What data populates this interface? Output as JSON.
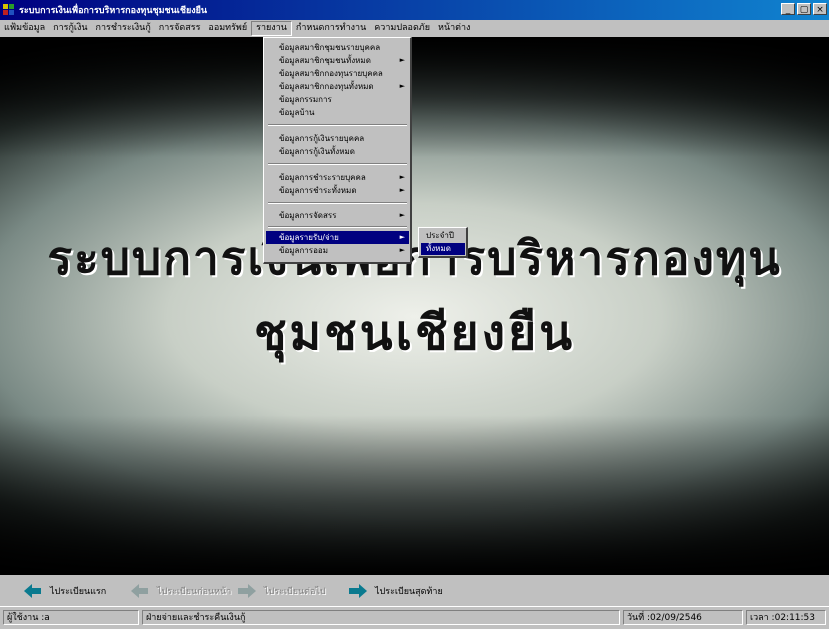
{
  "window": {
    "title": "ระบบการเงินเพื่อการบริหารกองทุนชุมชนเชียงยืน",
    "controls": [
      "_",
      "▢",
      "×"
    ]
  },
  "menubar": [
    {
      "label": "แฟ้มข้อมูล"
    },
    {
      "label": "การกู้เงิน"
    },
    {
      "label": "การชำระเงินกู้"
    },
    {
      "label": "การจัดสรร"
    },
    {
      "label": "ออมทรัพย์"
    },
    {
      "label": "รายงาน",
      "active": true
    },
    {
      "label": "กำหนดการทำงาน"
    },
    {
      "label": "ความปลอดภัย"
    },
    {
      "label": "หน้าต่าง"
    }
  ],
  "report_menu": {
    "items": [
      {
        "label": "ข้อมูลสมาชิกชุมชนรายบุคคล",
        "submenu": false
      },
      {
        "label": "ข้อมูลสมาชิกชุมชนทั้งหมด",
        "submenu": true
      },
      {
        "label": "ข้อมูลสมาชิกกองทุนรายบุคคล",
        "submenu": false
      },
      {
        "label": "ข้อมูลสมาชิกกองทุนทั้งหมด",
        "submenu": true
      },
      {
        "label": "ข้อมูลกรรมการ",
        "submenu": false
      },
      {
        "label": "ข้อมูลบ้าน",
        "submenu": false
      },
      {
        "label": "ข้อมูลการกู้เงินรายบุคคล",
        "submenu": false
      },
      {
        "label": "ข้อมูลการกู้เงินทั้งหมด",
        "submenu": false
      },
      {
        "label": "ข้อมูลการชำระรายบุคคล",
        "submenu": true
      },
      {
        "label": "ข้อมูลการชำระทั้งหมด",
        "submenu": true
      },
      {
        "label": "ข้อมูลการจัดสรร",
        "submenu": true
      },
      {
        "label": "ข้อมูลรายรับ/จ่าย",
        "submenu": true,
        "highlighted": true
      },
      {
        "label": "ข้อมูลการออม",
        "submenu": true
      }
    ],
    "submenu_arrow": "►"
  },
  "income_submenu": {
    "items": [
      {
        "label": "ประจำปี",
        "highlighted": false
      },
      {
        "label": "ทั้งหมด",
        "highlighted": true
      }
    ]
  },
  "banner": {
    "line1": "ระบบการเงินเพื่อการบริหารกองทุน",
    "line2": "ชุมชนเชียงยืน"
  },
  "navigation": {
    "first": {
      "label": "ไประเบียนแรก",
      "enabled": true
    },
    "previous": {
      "label": "ไประเบียนก่อนหน้า",
      "enabled": false
    },
    "next": {
      "label": "ไประเบียนต่อไป",
      "enabled": false
    },
    "last": {
      "label": "ไประเบียนสุดท้าย",
      "enabled": true
    }
  },
  "statusbar": {
    "user": "ผู้ใช้งาน :a",
    "module": "ฝ่ายจ่ายและชำระคืนเงินกู้",
    "date": "วันที่ :02/09/2546",
    "time": "เวลา :02:11:53"
  },
  "colors": {
    "titlebar_start": "#000080",
    "titlebar_end": "#1084d0",
    "highlight": "#000080",
    "nav_arrow": "#0a7a8f",
    "face": "#c0c0c0"
  }
}
